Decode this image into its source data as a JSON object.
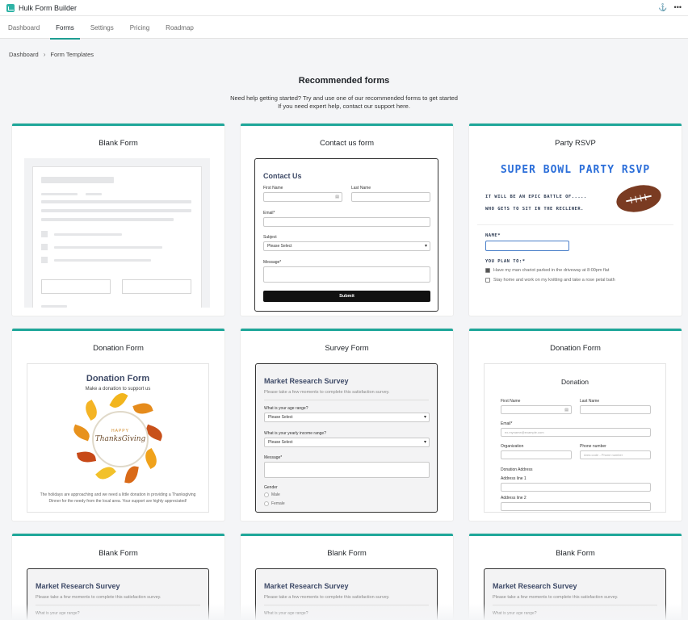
{
  "app": {
    "title": "Hulk Form Builder",
    "pin_icon": "pin-icon",
    "more_icon": "more-icon",
    "more_glyph": "•••"
  },
  "tabs": [
    {
      "label": "Dashboard"
    },
    {
      "label": "Forms",
      "active": true
    },
    {
      "label": "Settings"
    },
    {
      "label": "Pricing"
    },
    {
      "label": "Roadmap"
    }
  ],
  "breadcrumb": {
    "root": "Dashboard",
    "current": "Form Templates"
  },
  "page": {
    "heading": "Recommended forms",
    "sub_line1": "Need help getting started? Try and use one of our recommended forms to get started",
    "sub_line2": "If you need expert help, contact our support here."
  },
  "colors": {
    "accent": "#1fa79a",
    "form_heading": "#3e4a67",
    "rsvp_blue": "#2b6ed9"
  },
  "cards": {
    "c1": {
      "title": "Blank Form"
    },
    "c2": {
      "title": "Contact us form",
      "form_title": "Contact Us",
      "first_name": "First Name",
      "last_name": "Last Name",
      "email": "Email*",
      "subject": "Subject",
      "subject_value": "Please Select",
      "message": "Message*",
      "submit": "Submit"
    },
    "c3": {
      "title": "Party RSVP",
      "banner": "SUPER BOWL PARTY RSVP",
      "line1": "IT WILL BE AN EPIC BATTLE OF.....",
      "line2": "WHO GETS TO SIT IN THE RECLINER.",
      "name_label": "NAME*",
      "plan_label": "YOU PLAN TO:*",
      "opt1": "Have my man chariot parked in the driveway at 8:00pm flat",
      "opt2": "Stay home and work on my knitting and take a rose petal bath"
    },
    "c4": {
      "title": "Donation Form",
      "form_title": "Donation Form",
      "subtitle": "Make a donation to support us",
      "wreath_top": "HAPPY",
      "wreath_main": "ThanksGiving",
      "body": "The holidays are approaching and we need a little donation in providing a Thanksgiving Dinner for the needy from the local area. Your support are highly appreciated!"
    },
    "c5": {
      "title": "Survey Form",
      "form_title": "Market Research Survey",
      "subtitle": "Please take a few moments to complete this satisfaction survey.",
      "q1": "What is your age range?",
      "q1_value": "Please Select",
      "q2": "What is your yearly income range?",
      "q2_value": "Please Select",
      "message": "Message*",
      "gender": "Gender",
      "male": "Male",
      "female": "Female"
    },
    "c6": {
      "title": "Donation Form",
      "form_title": "Donation",
      "first_name": "First Name",
      "last_name": "Last Name",
      "email": "Email*",
      "email_placeholder": "ex.myname@example.com",
      "organization": "Organization",
      "phone": "Phone number",
      "phone_placeholder": "Area code - Phone number",
      "address": "Donation Address",
      "addr1": "Address line 1",
      "addr2": "Address line 2"
    },
    "c7": {
      "title": "Blank Form",
      "form_title": "Market Research Survey",
      "subtitle": "Please take a few moments to complete this satisfaction survey.",
      "q1": "What is your age range?"
    },
    "c8": {
      "title": "Blank Form",
      "form_title": "Market Research Survey",
      "subtitle": "Please take a few moments to complete this satisfaction survey.",
      "q1": "What is your age range?"
    },
    "c9": {
      "title": "Blank Form",
      "form_title": "Market Research Survey",
      "subtitle": "Please take a few moments to complete this satisfaction survey.",
      "q1": "What is your age range?"
    }
  }
}
